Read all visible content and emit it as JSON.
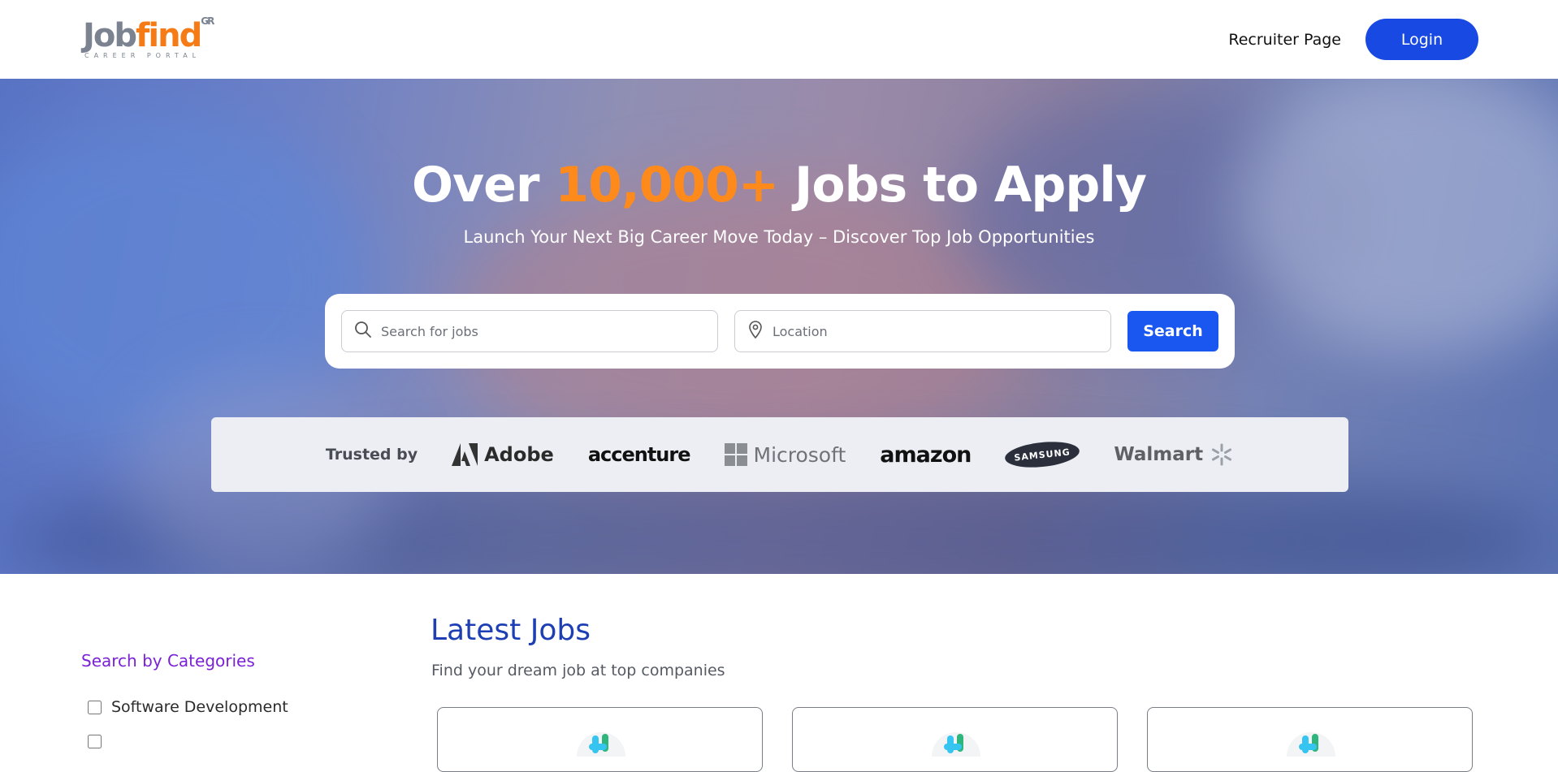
{
  "header": {
    "logo_main_job": "Job",
    "logo_main_find": "find",
    "logo_sup": "GR",
    "logo_sub": "CAREER PORTAL",
    "recruiter_link": "Recruiter Page",
    "login_label": "Login"
  },
  "hero": {
    "title_prefix": "Over",
    "title_highlight": "10,000+",
    "title_suffix": "Jobs to Apply",
    "subtitle": "Launch Your Next Big Career Move Today – Discover Top Job Opportunities"
  },
  "search": {
    "jobs_placeholder": "Search for jobs",
    "location_placeholder": "Location",
    "button_label": "Search"
  },
  "trusted": {
    "label": "Trusted by",
    "brands": [
      "Adobe",
      "accenture",
      "Microsoft",
      "amazon",
      "SAMSUNG",
      "Walmart"
    ]
  },
  "sidebar": {
    "title": "Search by Categories",
    "categories": [
      "Software Development"
    ]
  },
  "main": {
    "title": "Latest Jobs",
    "subtitle": "Find your dream job at top companies"
  },
  "colors": {
    "primary": "#1849e3",
    "accent_orange": "#ff8a1c",
    "category_purple": "#7a22d6",
    "heading_blue": "#1d3fb3"
  },
  "icons": [
    "search-icon",
    "location-pin-icon",
    "checkbox-icon",
    "slack-logo-icon"
  ]
}
